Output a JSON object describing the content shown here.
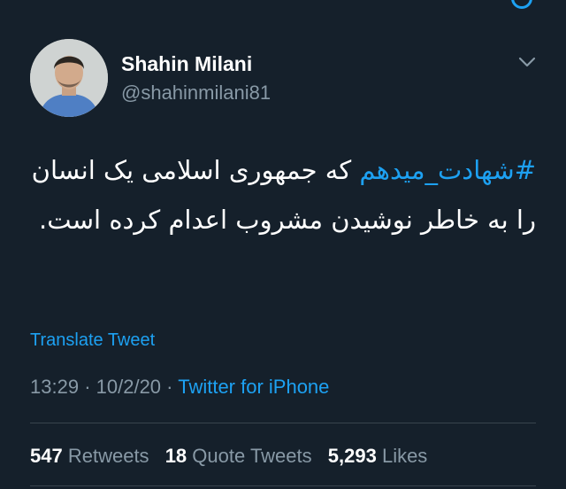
{
  "tweet": {
    "author": {
      "display_name": "Shahin Milani",
      "handle": "@shahinmilani81"
    },
    "text": {
      "hashtag": "#شهادت_میدهم",
      "body": " که جمهوری اسلامی یک انسان را به خاطر نوشیدن مشروب اعدام کرده است."
    },
    "translate_label": "Translate Tweet",
    "time": "13:29",
    "date": "10/2/20",
    "separator": "·",
    "source": "Twitter for iPhone",
    "stats": {
      "retweets_count": "547",
      "retweets_label": "Retweets",
      "quote_count": "18",
      "quote_label": "Quote Tweets",
      "likes_count": "5,293",
      "likes_label": "Likes"
    }
  },
  "colors": {
    "background": "#15202b",
    "accent": "#1da1f2",
    "secondary_text": "#8899a6",
    "divider": "#38444d"
  },
  "icons": {
    "menu": "chevron-down-icon",
    "top_edge": "circle-icon"
  }
}
